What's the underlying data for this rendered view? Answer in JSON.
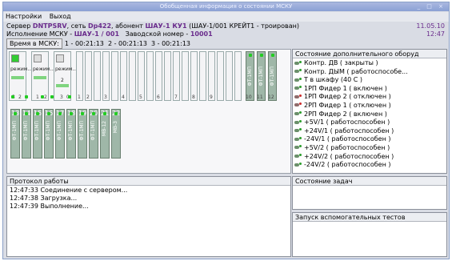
{
  "window": {
    "title": "Обобщенная информация о состоянии МСКУ",
    "controls": "_ □ ×"
  },
  "menu": [
    {
      "label": "Настройки"
    },
    {
      "label": "Выход"
    }
  ],
  "server_line": {
    "prefix": "Сервер ",
    "server": "DNTPSRV",
    "network_label": ", сеть ",
    "network": "Dp422",
    "subscriber_label": ", абонент ",
    "subscriber": "ШАУ-1 КУ1",
    "suffix": " (ШАУ-1/001 КРЕЙТ1 - троирован)",
    "date": "11.05.10"
  },
  "exec_line": {
    "prefix": "Исполнение МСКУ - ",
    "version": "ШАУ-1 / 001",
    "factory_label": "   Заводской номер - ",
    "factory": "10001",
    "time": "12:47"
  },
  "msku_time": {
    "label": "Время в МСКУ:",
    "values": "1 - 00:21:13  2 - 00:21:13  3 - 00:21:13"
  },
  "rack_top": {
    "modules": [
      {
        "label": "режим...",
        "num": "1",
        "state": "on"
      },
      {
        "label": "режим...",
        "num": "2",
        "state": "off"
      },
      {
        "label": "режим...",
        "num": "3",
        "state": "off"
      }
    ],
    "slots": [
      "3",
      "4",
      "5",
      "6",
      "7",
      "8",
      "9",
      "10",
      "11",
      "12"
    ],
    "cards": [
      {
        "text": "ФТ-1МП",
        "num": "10"
      },
      {
        "text": "ФТ-1МП",
        "num": "11"
      },
      {
        "text": "ФТ-1МП",
        "num": "12"
      }
    ],
    "bottom_nums": [
      "3",
      "2",
      "1",
      "2",
      "3",
      "0",
      "1",
      "2",
      "3",
      "4",
      "5",
      "6",
      "7",
      "8",
      "9",
      "10",
      "11",
      "12"
    ]
  },
  "rack_bottom": {
    "cards": [
      {
        "text": "ФТ-1МП",
        "num": "13"
      },
      {
        "text": "ФТ-1МП",
        "num": "14"
      },
      {
        "text": "ФТ-1МП",
        "num": "15"
      },
      {
        "text": "ФТ-1МП",
        "num": "16"
      },
      {
        "text": "ФТ-1МП",
        "num": "17"
      },
      {
        "text": "ФТ-1МП",
        "num": "18"
      },
      {
        "text": "ФТ-1МП",
        "num": "19"
      },
      {
        "text": "ФТ-1МП",
        "num": "20"
      },
      {
        "text": "МВ-12",
        "num": "21"
      },
      {
        "text": "МВ-3",
        "num": "22"
      }
    ]
  },
  "extra_state": {
    "header": "Состояние дополнительного оборуд",
    "items": [
      {
        "text": "Контр. ДВ ( закрыты )",
        "color": "#2a9d2a"
      },
      {
        "text": "Контр. ДЫМ ( работоспособе...",
        "color": "#2a9d2a"
      },
      {
        "text": "Т в шкафу (40 С )",
        "color": "#2a9d2a"
      },
      {
        "text": "1РП Фидер 1 ( включен )",
        "color": "#2a9d2a"
      },
      {
        "text": "1РП Фидер 2 ( отключен )",
        "color": "#cc2a2a"
      },
      {
        "text": "2РП Фидер 1 ( отключен )",
        "color": "#cc2a2a"
      },
      {
        "text": "2РП Фидер 2 ( включен )",
        "color": "#2a9d2a"
      },
      {
        "text": "+5V/1 ( работоспособен )",
        "color": "#2a9d2a"
      },
      {
        "text": "+24V/1 ( работоспособен )",
        "color": "#2a9d2a"
      },
      {
        "text": "-24V/1 ( работоспособен )",
        "color": "#2a9d2a"
      },
      {
        "text": "+5V/2 ( работоспособен )",
        "color": "#2a9d2a"
      },
      {
        "text": "+24V/2 ( работоспособен )",
        "color": "#2a9d2a"
      },
      {
        "text": "-24V/2 ( работоспособен )",
        "color": "#2a9d2a"
      }
    ]
  },
  "protocol": {
    "header": "Протокол работы",
    "entries": [
      "12:47:33 Соединение с сервером...",
      "12:47:38 Загрузка...",
      "12:47:39 Выполнение..."
    ]
  },
  "tasks": {
    "header": "Состояние задач"
  },
  "tests": {
    "header": "Запуск вспомогательных тестов"
  }
}
